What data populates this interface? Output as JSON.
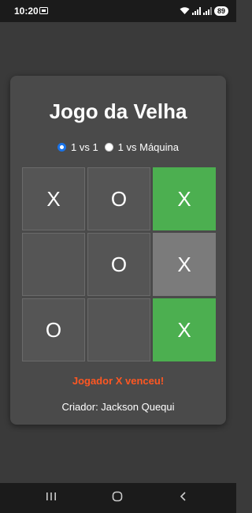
{
  "status_bar": {
    "time": "10:20",
    "battery": "89"
  },
  "app": {
    "title": "Jogo da Velha",
    "modes": [
      {
        "label": "1 vs 1",
        "selected": true
      },
      {
        "label": "1 vs Máquina",
        "selected": false
      }
    ],
    "board": [
      {
        "value": "X",
        "state": "normal"
      },
      {
        "value": "O",
        "state": "normal"
      },
      {
        "value": "X",
        "state": "win"
      },
      {
        "value": "",
        "state": "normal"
      },
      {
        "value": "O",
        "state": "normal"
      },
      {
        "value": "X",
        "state": "hover"
      },
      {
        "value": "O",
        "state": "normal"
      },
      {
        "value": "",
        "state": "normal"
      },
      {
        "value": "X",
        "state": "win"
      }
    ],
    "result": "Jogador X venceu!",
    "creator": "Criador: Jackson Quequi"
  },
  "colors": {
    "background": "#3a3a3a",
    "card": "#4a4a4a",
    "cell": "#555555",
    "win": "#4caf50",
    "hover_cell": "#7b7b7b",
    "result_text": "#ff5722",
    "radio_selected": "#1a73e8"
  },
  "nav_bar": {
    "icons": [
      "recent-apps-icon",
      "home-icon",
      "back-icon"
    ]
  }
}
